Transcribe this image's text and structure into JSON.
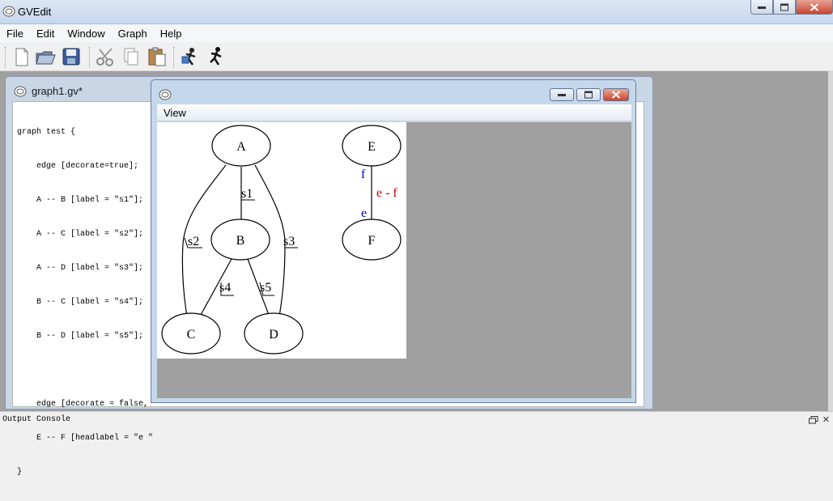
{
  "window": {
    "title": "GVEdit"
  },
  "menubar": {
    "items": [
      "File",
      "Edit",
      "Window",
      "Graph",
      "Help"
    ]
  },
  "toolbar": {
    "buttons": [
      "new-file-icon",
      "open-folder-icon",
      "save-disk-icon",
      "cut-scissors-icon",
      "copy-icon",
      "paste-icon",
      "layout-settings-icon",
      "run-layout-icon"
    ]
  },
  "document": {
    "title": "graph1.gv*",
    "code_lines": [
      "graph test {",
      "    edge [decorate=true];",
      "    A -- B [label = \"s1\"];",
      "    A -- C [label = \"s2\"];",
      "    A -- D [label = \"s3\"];",
      "    B -- C [label = \"s4\"];",
      "    B -- D [label = \"s5\"];",
      "",
      "    edge [decorate = false,",
      "    E -- F [headlabel = \"e \"",
      "}"
    ]
  },
  "view_window": {
    "menu": "View",
    "graph": {
      "nodes": [
        "A",
        "B",
        "C",
        "D",
        "E",
        "F"
      ],
      "edge_labels": [
        "s1",
        "s2",
        "s3",
        "s4",
        "s5"
      ],
      "ef_label": "e - f",
      "ef_taillabel": "f",
      "ef_headlabel": "e",
      "colors": {
        "label": "#cc0000",
        "taillabel": "#0000cc",
        "headlabel": "#0000cc"
      }
    }
  },
  "console": {
    "label": "Output Console"
  }
}
